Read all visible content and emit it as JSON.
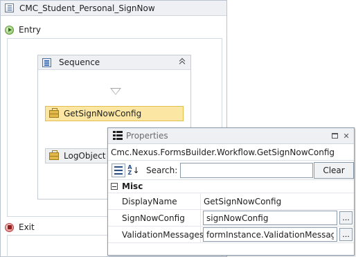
{
  "workflow": {
    "title": "CMC_Student_Personal_SignNow",
    "entry_label": "Entry",
    "exit_label": "Exit",
    "sequence": {
      "title": "Sequence",
      "activities": [
        {
          "label": "GetSignNowConfig",
          "selected": true
        },
        {
          "label": "LogObject",
          "selected": false
        }
      ]
    }
  },
  "properties": {
    "window_title": "Properties",
    "object_type": "Cmc.Nexus.FormsBuilder.Workflow.GetSignNowConfig",
    "search": {
      "label": "Search:",
      "value": "",
      "clear_label": "Clear"
    },
    "category": "Misc",
    "rows": [
      {
        "name": "DisplayName",
        "value": "GetSignNowConfig"
      },
      {
        "name": "SignNowConfig",
        "value": "signNowConfig"
      },
      {
        "name": "ValidationMessages",
        "value": "formInstance.ValidationMessages"
      }
    ],
    "ellipsis_label": "...",
    "close_glyph": "✕"
  },
  "colors": {
    "selected_activity_bg": "#fbe7a3",
    "selected_activity_border": "#e2be4e",
    "header_bg": "#eef0f3"
  },
  "icons": [
    "workflow-icon",
    "entry-icon",
    "exit-icon",
    "sequence-icon",
    "collapse-icon",
    "drop-arrow-icon",
    "activity-icon",
    "properties-icon",
    "maximize-icon",
    "close-icon",
    "categorized-icon",
    "alphabetical-icon"
  ]
}
